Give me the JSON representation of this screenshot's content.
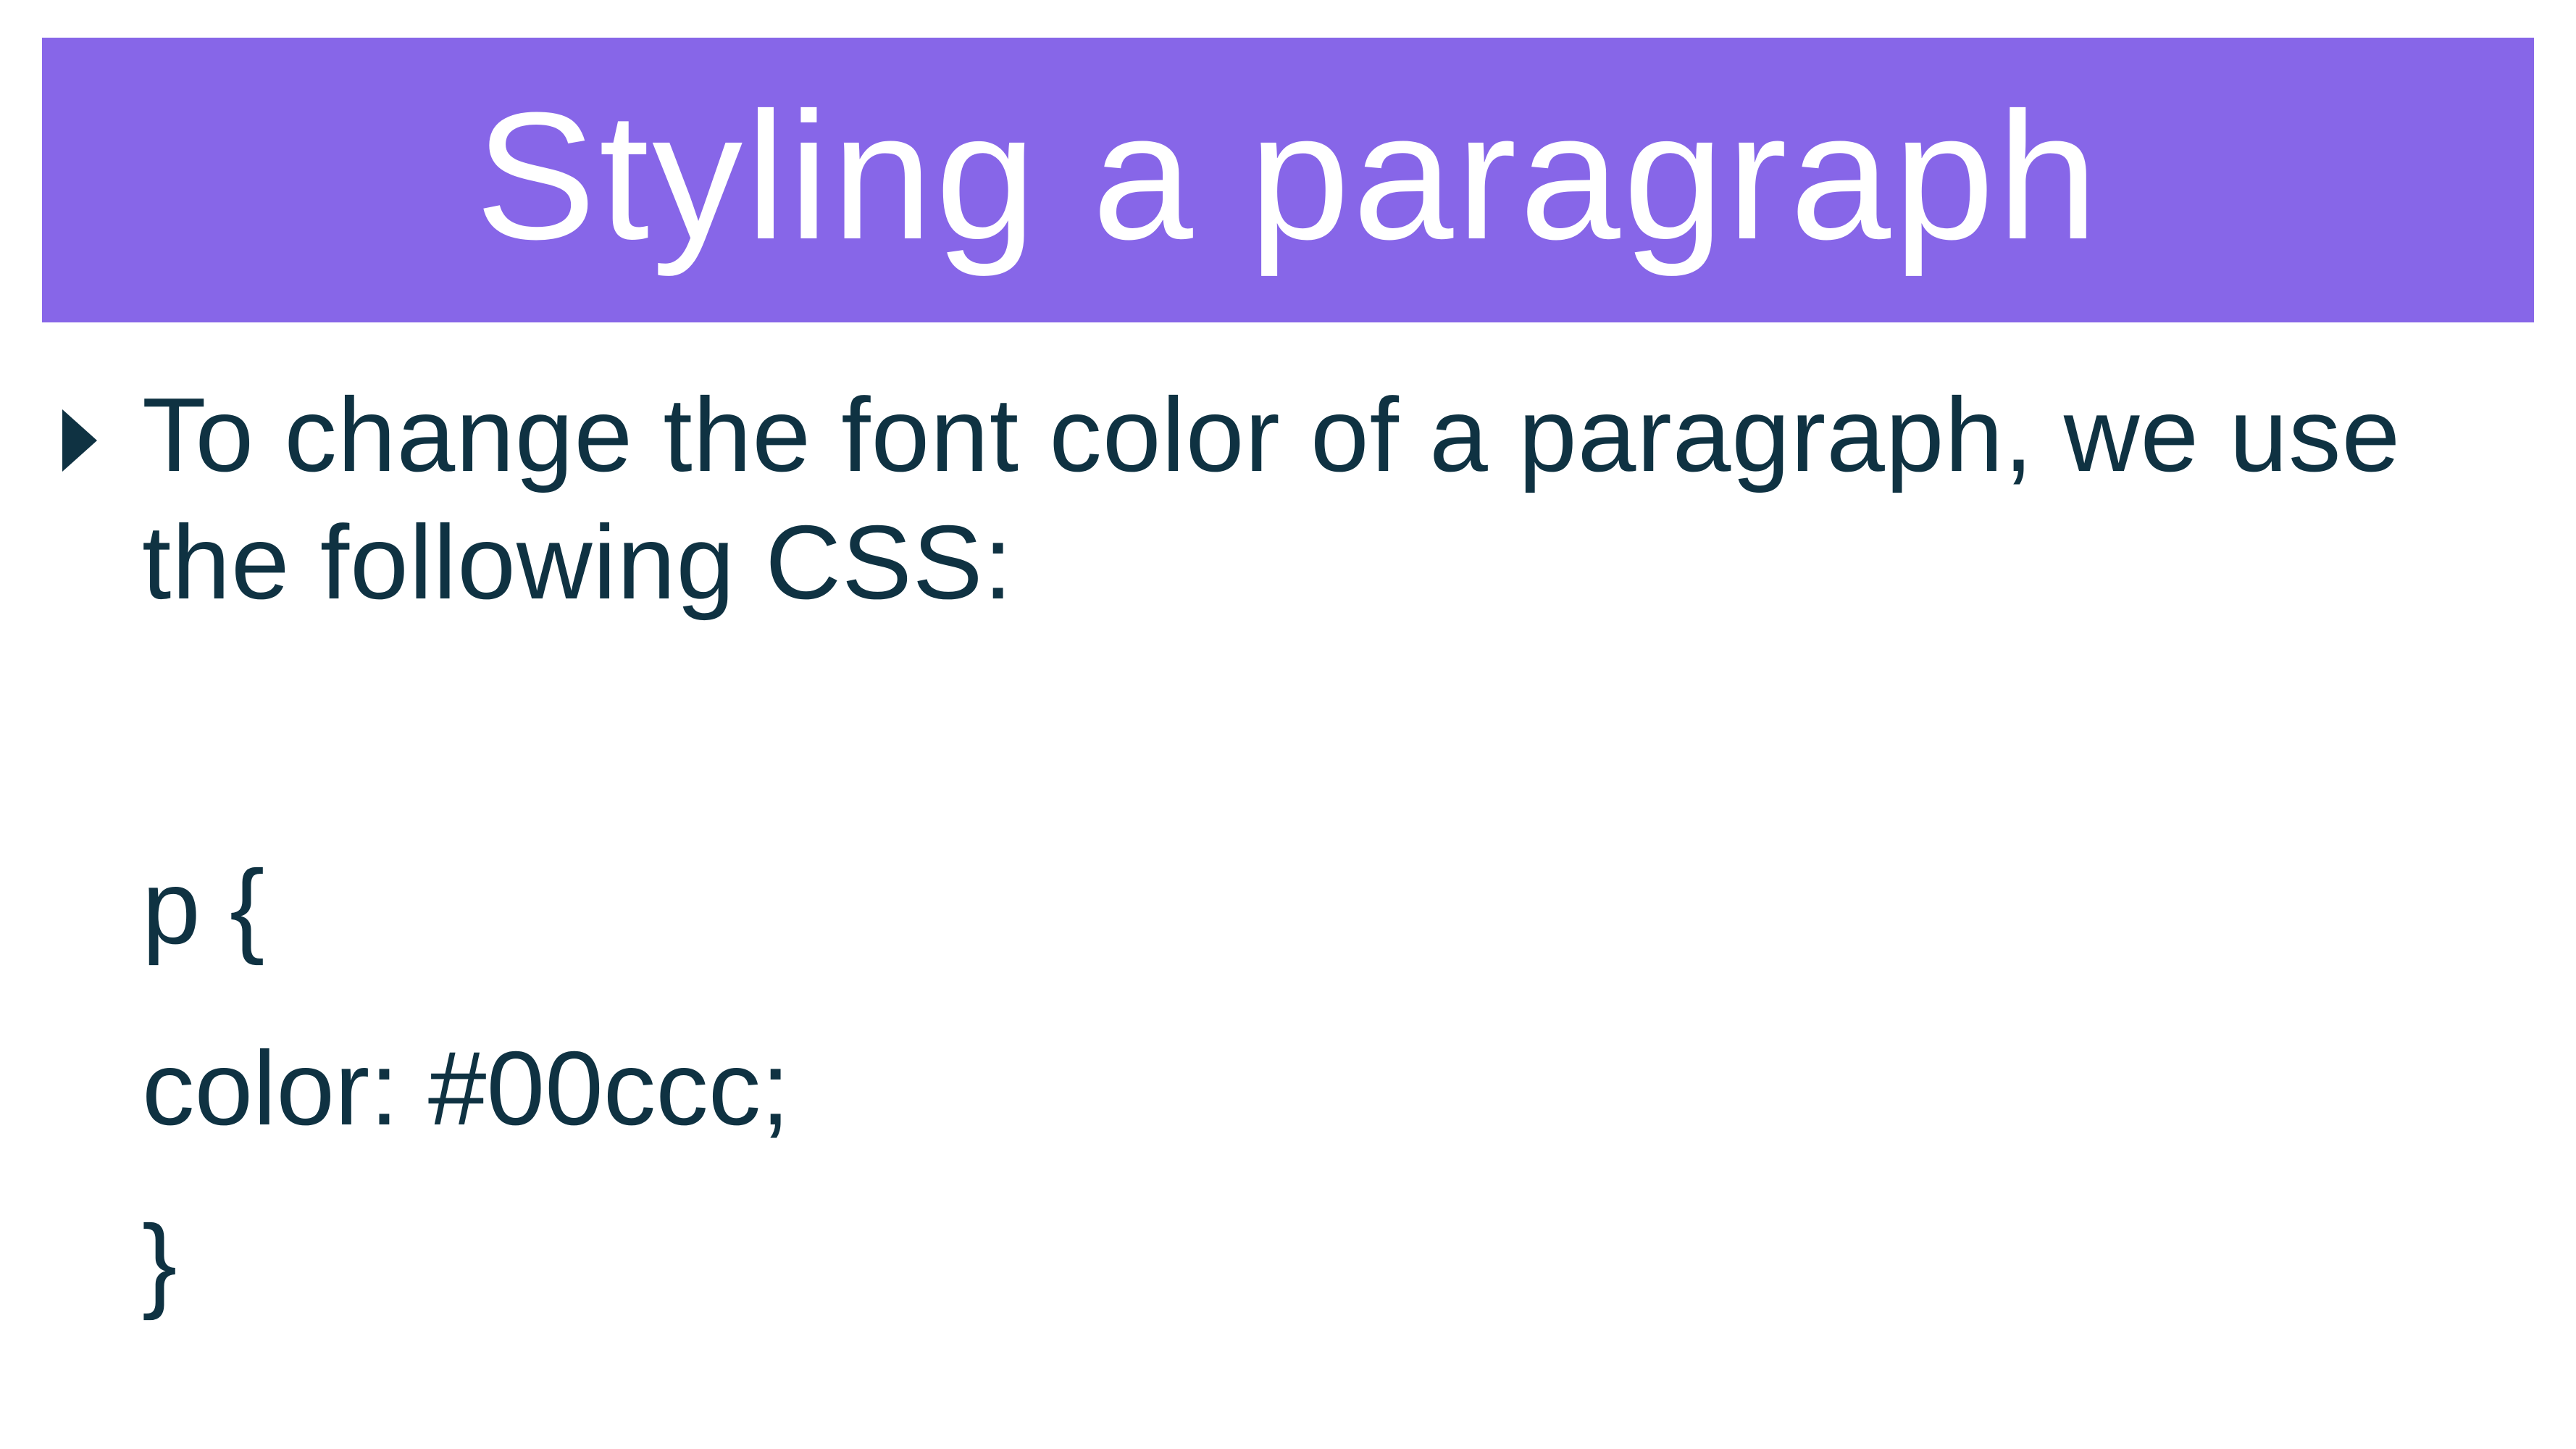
{
  "slide": {
    "title": "Styling a paragraph",
    "bullet": "To change the font color of a paragraph, we use the following CSS:",
    "code_lines": [
      "p {",
      "color: #00ccc;",
      "}"
    ]
  },
  "colors": {
    "title_bar": "#8766e8",
    "title_text": "#ffffff",
    "body_text": "#0f3242",
    "background": "#ffffff"
  },
  "icons": {
    "bullet": "triangle-right-icon"
  }
}
